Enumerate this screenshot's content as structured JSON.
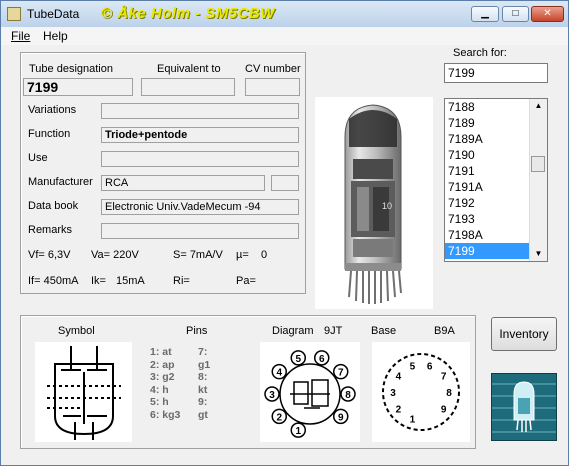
{
  "window": {
    "title": "TubeData",
    "banner": "© Åke Holm - SM5CBW"
  },
  "menu": {
    "file": "File",
    "help": "Help"
  },
  "form": {
    "designation_label": "Tube designation",
    "designation_value": "7199",
    "equivalent_label": "Equivalent to",
    "equivalent_value": "",
    "cv_label": "CV number",
    "cv_value": "",
    "variations_label": "Variations",
    "variations_value": "",
    "function_label": "Function",
    "function_value": "Triode+pentode",
    "use_label": "Use",
    "use_value": "",
    "manufacturer_label": "Manufacturer",
    "manufacturer_value": "RCA",
    "manufacturer_code": "",
    "databook_label": "Data book",
    "databook_value": "Electronic Univ.VadeMecum -94",
    "remarks_label": "Remarks",
    "remarks_value": ""
  },
  "specs": {
    "vf": "Vf= 6,3V",
    "va": "Va= 220V",
    "s": "S= 7mA/V",
    "mu": "µ=",
    "mu_value": "0",
    "if": "If= 450mA",
    "ik": "Ik=",
    "ik_value": "15mA",
    "ri": "Ri=",
    "pa": "Pa="
  },
  "search": {
    "label": "Search for:",
    "value": "7199"
  },
  "tube_list": {
    "items": [
      "7188",
      "7189",
      "7189A",
      "7190",
      "7191",
      "7191A",
      "7192",
      "7193",
      "7198A",
      "7199"
    ],
    "selected": "7199"
  },
  "bottom": {
    "symbol_label": "Symbol",
    "pins_label": "Pins",
    "diagram_label": "Diagram",
    "diagram_code": "9JT",
    "base_label": "Base",
    "base_code": "B9A",
    "pins_col1": [
      "1: at",
      "2: ap",
      "3: g2",
      "4: h",
      "5: h",
      "6: kg3"
    ],
    "pins_col2": [
      "7: g1",
      "8: kt",
      "9: gt"
    ],
    "diagram_pins": [
      "1",
      "2",
      "3",
      "4",
      "5",
      "6",
      "7",
      "8",
      "9"
    ],
    "base_pins": [
      "1",
      "2",
      "3",
      "4",
      "5",
      "6",
      "7",
      "8",
      "9"
    ]
  },
  "inventory_button": "Inventory",
  "colors": {
    "selection": "#3399ff",
    "banner": "#e8e800",
    "close": "#c8432a"
  }
}
